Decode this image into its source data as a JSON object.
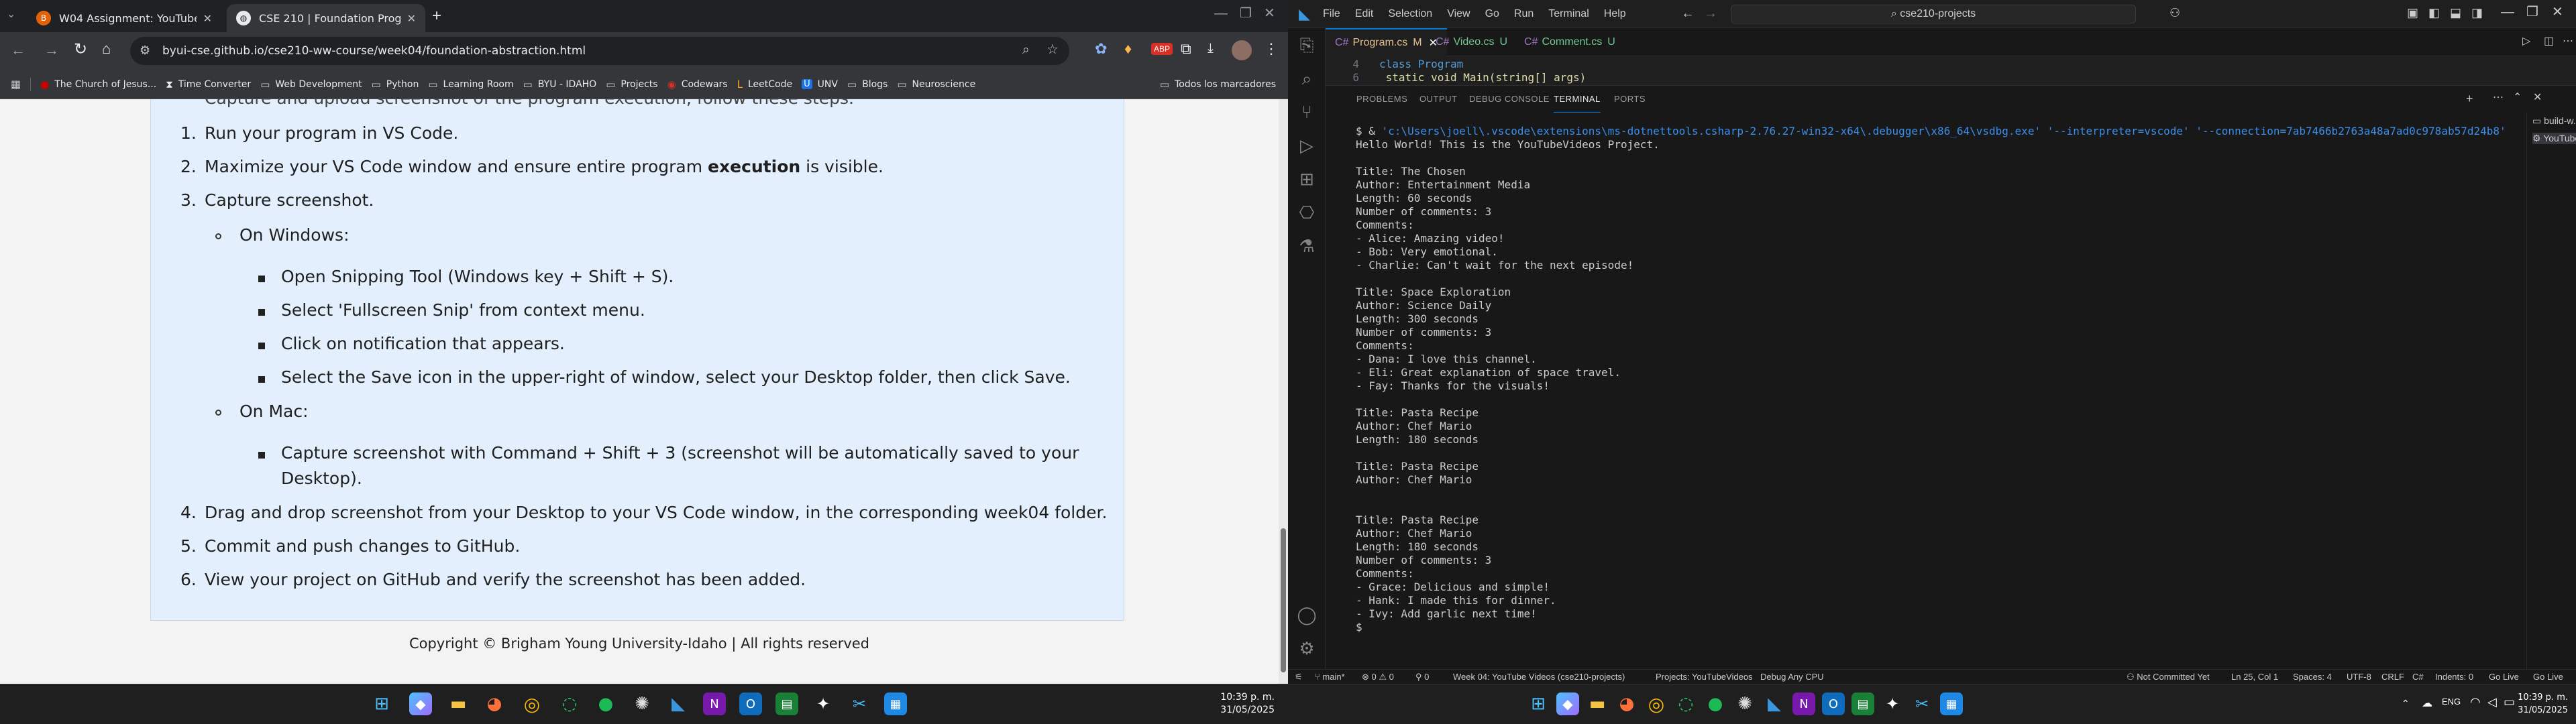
{
  "chrome": {
    "tabs": [
      {
        "label": "W04 Assignment: YouTube Vid..."
      },
      {
        "label": "CSE 210 | Foundation Program"
      }
    ],
    "url": "byui-cse.github.io/cse210-ww-course/week04/foundation-abstraction.html",
    "bookmarks": [
      "The Church of Jesus...",
      "Time Converter",
      "Web Development",
      "Python",
      "Learning Room",
      "BYU - IDAHO",
      "Projects",
      "Codewars",
      "LeetCode",
      "UNV",
      "Blogs",
      "Neuroscience"
    ],
    "bookmarks_other": "Todos los marcadores"
  },
  "doc": {
    "cut_line": "Capture and upload screenshot of the program execution, follow these steps.",
    "steps": {
      "s1": "Run your program in VS Code.",
      "s2a": "Maximize your VS Code window and ensure entire program ",
      "s2b": "execution",
      "s2c": " is visible.",
      "s3": "Capture screenshot.",
      "windows": "On Windows:",
      "w1": "Open Snipping Tool (Windows key + Shift + S).",
      "w2": "Select 'Fullscreen Snip' from context menu.",
      "w3": "Click on notification that appears.",
      "w4": "Select the Save icon in the upper-right of window, select your Desktop folder, then click Save.",
      "mac": "On Mac:",
      "m1": "Capture screenshot with Command + Shift + 3 (screenshot will be automatically saved to your",
      "m1b": "Desktop).",
      "s4": "Drag and drop screenshot from your Desktop to your VS Code window, in the corresponding week04 folder.",
      "s5": "Commit and push changes to GitHub.",
      "s6": "View your project on GitHub and verify the screenshot has been added."
    },
    "nums": [
      "1.",
      "2.",
      "3.",
      "4.",
      "5.",
      "6."
    ],
    "footer": "Copyright © Brigham Young University-Idaho | All rights reserved"
  },
  "taskbar": {
    "time": "10:39 p. m.",
    "date": "31/05/2025",
    "lang": "ENG"
  },
  "vscode": {
    "menu": [
      "File",
      "Edit",
      "Selection",
      "View",
      "Go",
      "Run",
      "Terminal",
      "Help"
    ],
    "search": "cse210-projects",
    "tabs": [
      {
        "label": "Program.cs",
        "badge": "M"
      },
      {
        "label": "Video.cs",
        "badge": "U"
      },
      {
        "label": "Comment.cs",
        "badge": "U"
      }
    ],
    "code": [
      {
        "ln": "4",
        "text": "class Program"
      },
      {
        "ln": "6",
        "text": "    static void Main(string[] args)"
      }
    ],
    "panel_tabs": [
      "PROBLEMS",
      "OUTPUT",
      "DEBUG CONSOLE",
      "TERMINAL",
      "PORTS"
    ],
    "terminal_side": [
      "build-w...",
      "YouTubeVid..."
    ],
    "cmd": {
      "prompt": "$ & ",
      "path": "'c:\\Users\\joell\\.vscode\\extensions\\ms-dotnettools.csharp-2.76.27-win32-x64\\.debugger\\x86_64\\vsdbg.exe' '--interpreter=vscode' '--connection=7ab7466b2763a48a7ad0c978ab57d24b8'"
    },
    "terminal": [
      "Hello World! This is the YouTubeVideos Project.",
      "",
      "Title: The Chosen",
      "Author: Entertainment Media",
      "Length: 60 seconds",
      "Number of comments: 3",
      "Comments:",
      "- Alice: Amazing video!",
      "- Bob: Very emotional.",
      "- Charlie: Can't wait for the next episode!",
      "",
      "Title: Space Exploration",
      "Author: Science Daily",
      "Length: 300 seconds",
      "Number of comments: 3",
      "Comments:",
      "- Dana: I love this channel.",
      "- Eli: Great explanation of space travel.",
      "- Fay: Thanks for the visuals!",
      "",
      "Title: Pasta Recipe",
      "Author: Chef Mario",
      "Length: 180 seconds",
      "",
      "Title: Pasta Recipe",
      "Author: Chef Mario",
      "",
      "",
      "Title: Pasta Recipe",
      "Author: Chef Mario",
      "Length: 180 seconds",
      "Number of comments: 3",
      "Comments:",
      "- Grace: Delicious and simple!",
      "- Hank: I made this for dinner.",
      "- Ivy: Add garlic next time!",
      "$"
    ],
    "status": {
      "branch": "main*",
      "problems": "⊗ 0 ⚠ 0",
      "errors2": "0",
      "project": "Week 04: YouTube Videos (cse210-projects)",
      "projects": "Projects: YouTubeVideos",
      "debug": "Debug Any CPU",
      "commit": "Not Committed Yet",
      "pos": "Ln 25, Col 1",
      "spaces": "Spaces: 4",
      "enc": "UTF-8",
      "eol": "CRLF",
      "lang": "C#",
      "indents": "Indents: 0",
      "golive1": "Go Live",
      "golive2": "Go Live"
    }
  }
}
